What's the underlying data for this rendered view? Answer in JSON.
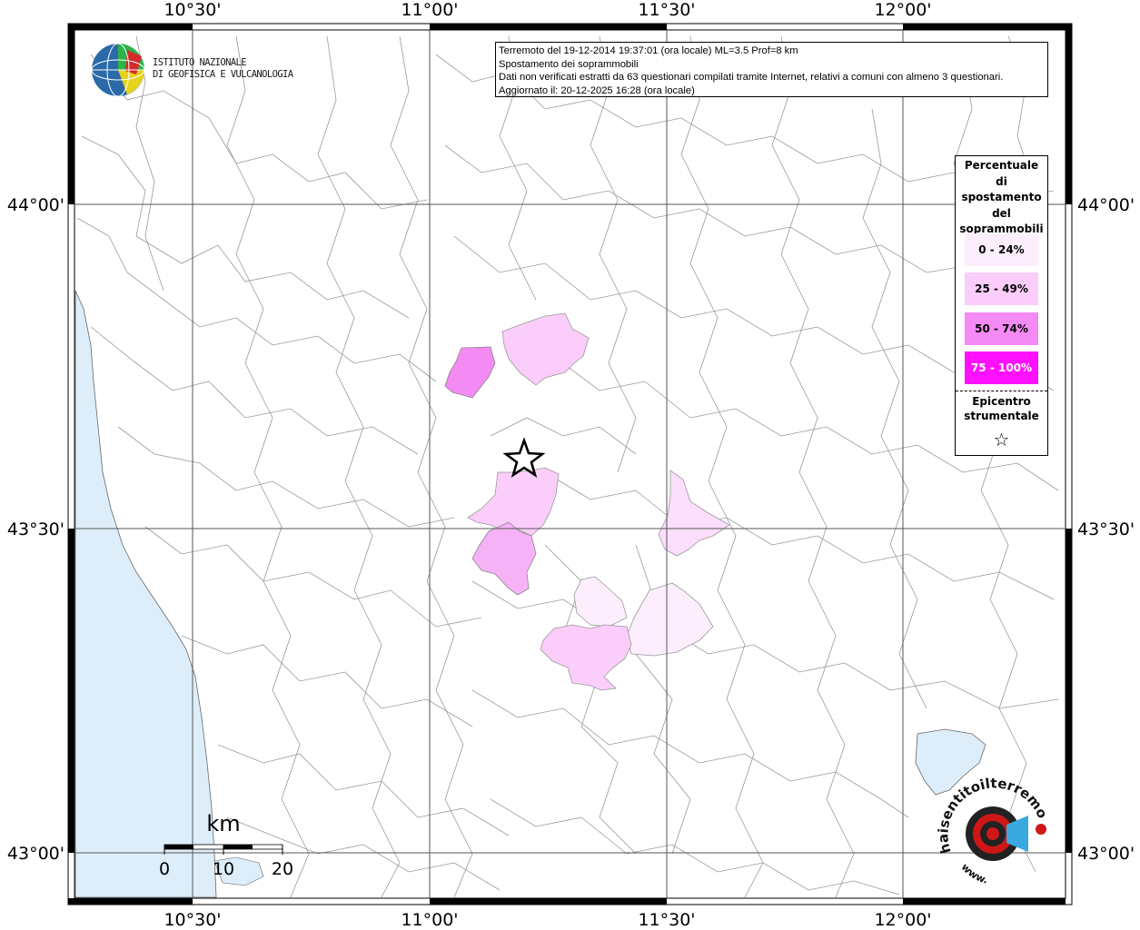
{
  "header": {
    "line1": "Terremoto del 19-12-2014 19:37:01 (ora locale) ML=3.5 Prof=8 km",
    "line2": "Spostamento dei soprammobili",
    "line3": "Dati non verificati estratti da 63 questionari compilati tramite Internet, relativi a comuni con almeno 3 questionari.",
    "line4": "Aggiornato il: 20-12-2025 16:28 (ora locale)"
  },
  "institute": {
    "line1": "ISTITUTO NAZIONALE",
    "line2": "DI GEOFISICA E VULCANOLOGIA"
  },
  "axes": {
    "top": [
      "10°30'",
      "11°00'",
      "11°30'",
      "12°00'"
    ],
    "bottom": [
      "10°30'",
      "11°00'",
      "11°30'",
      "12°00'"
    ],
    "left": [
      "44°00'",
      "43°30'",
      "43°00'"
    ],
    "right": [
      "44°00'",
      "43°30'",
      "43°00'"
    ]
  },
  "legend": {
    "title": [
      "Percentuale",
      "di",
      "spostamento",
      "del",
      "soprammobili"
    ],
    "classes": [
      {
        "label": "0 - 24%",
        "color": "#fdeefd"
      },
      {
        "label": "25 - 49%",
        "color": "#fbcdfb"
      },
      {
        "label": "50 - 74%",
        "color": "#f48af4"
      },
      {
        "label": "75 - 100%",
        "color": "#ff11ff",
        "text_color": "#ffffff"
      }
    ],
    "epicenter": [
      "Epicentro",
      "strumentale"
    ]
  },
  "scale": {
    "unit": "km",
    "ticks": [
      "0",
      "10",
      "20"
    ]
  },
  "colors": {
    "sea": "#ddeefa",
    "border": "#999999",
    "grid": "#555555"
  },
  "logo": {
    "text": "haisentitoilterremoto.it",
    "prefix": "www."
  }
}
